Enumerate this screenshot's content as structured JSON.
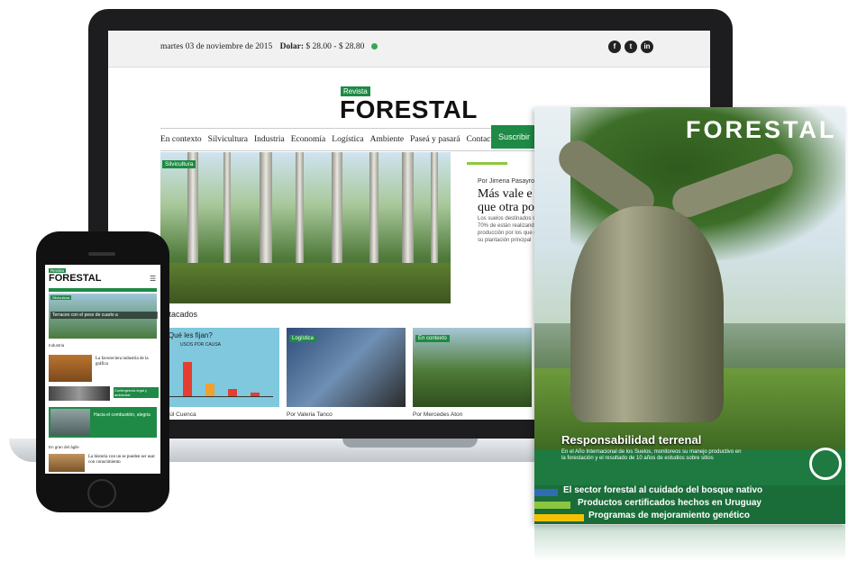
{
  "laptop": {
    "topbar": {
      "date": "martes 03 de noviembre de 2015",
      "dolar_label": "Dolar:",
      "dolar_value": "$ 28.00 - $ 28.80",
      "social": [
        "f",
        "t",
        "in"
      ]
    },
    "logo_small": "Revista",
    "logo_big": "FORESTAL",
    "nav": [
      "En contexto",
      "Silvicultura",
      "Industria",
      "Economía",
      "Logística",
      "Ambiente",
      "Paseá y pasará",
      "Contacto"
    ],
    "subscribe": "Suscribir",
    "hero_tag": "Silvicultura",
    "article": {
      "author": "Por Jimena Pasayro",
      "title_line1": "Más vale e",
      "title_line2": "que otra po",
      "text": "Los suelos destinados se dividen en 70% de están realizando en producción por los que no conversan su plantación principal"
    },
    "destacados": "estacados",
    "cards": [
      {
        "tag": "",
        "chart_title": "¿Qué les fijan?",
        "chart_subtitle": "USOS POR CAUSA",
        "by": "Raúl Cuenca"
      },
      {
        "tag": "Logística",
        "by": "Por Valeria Tanco"
      },
      {
        "tag": "En contexto",
        "by": "Por Mercedes Aton"
      }
    ]
  },
  "phone": {
    "logo_small": "Revista",
    "logo": "FORESTAL",
    "menu_icon": "menu-icon",
    "hero_tag": "Silvicultura",
    "hero_caption": "Terraceo con el peso de cuarto a",
    "section1": "Industria",
    "story2": "La favoreciera industria de la gráfica",
    "story3": "Contingencia legal y ambiental",
    "story4": "Hacia el combustión, alegria",
    "section2": "En gran del ágile",
    "story5": "La historia con un se pueden ser usar con conocimiento"
  },
  "magazine": {
    "title": "FORESTAL",
    "headline": "Responsabilidad terrenal",
    "headline_text": "En el Año Internacional de los Suelos, monitoreos su manejo productivo en la forestación y el resultado de 10 años de estudios sobre sitios",
    "lines": [
      "El sector forestal al cuidado del bosque nativo",
      "Productos certificados hechos en Uruguay",
      "Programas de mejoramiento genético"
    ],
    "bar_colors": [
      "#2e6db4",
      "#8cc63f",
      "#f2c200"
    ]
  }
}
